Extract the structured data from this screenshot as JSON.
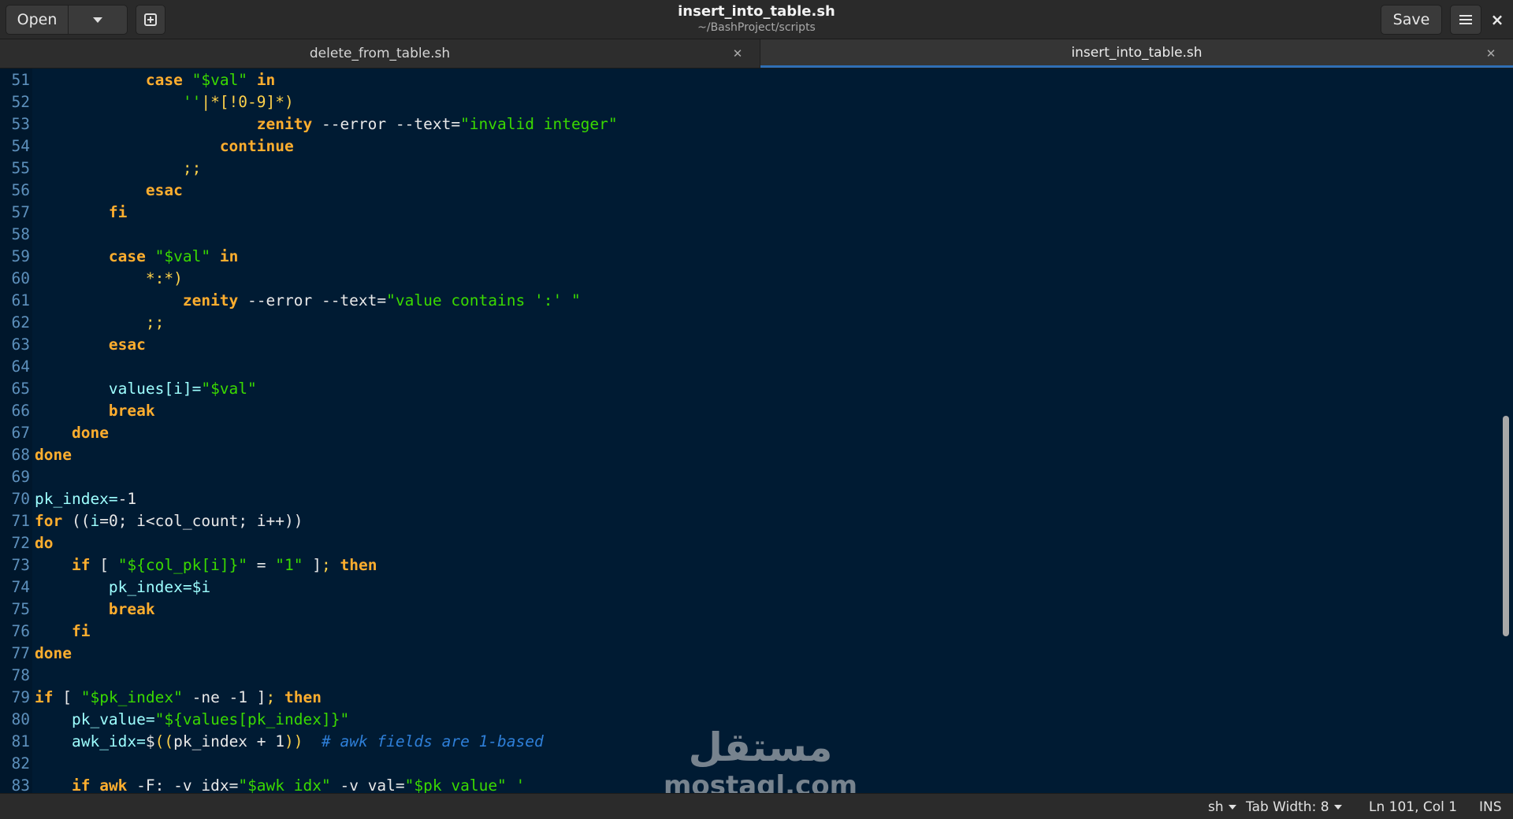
{
  "header": {
    "open_label": "Open",
    "save_label": "Save",
    "title": "insert_into_table.sh",
    "subtitle": "~/BashProject/scripts"
  },
  "tabs": [
    {
      "label": "delete_from_table.sh",
      "active": false
    },
    {
      "label": "insert_into_table.sh",
      "active": true
    }
  ],
  "editor": {
    "lines": [
      {
        "n": "51",
        "tokens": [
          [
            "            ",
            "plain"
          ],
          [
            "case",
            "kw"
          ],
          [
            " ",
            "plain"
          ],
          [
            "\"$val\"",
            "str"
          ],
          [
            " ",
            "plain"
          ],
          [
            "in",
            "kw"
          ]
        ]
      },
      {
        "n": "52",
        "tokens": [
          [
            "                ",
            "plain"
          ],
          [
            "''",
            "str"
          ],
          [
            "|*[!0-9]*)",
            "op"
          ]
        ]
      },
      {
        "n": "53",
        "tokens": [
          [
            "                        ",
            "plain"
          ],
          [
            "zenity",
            "kw"
          ],
          [
            " --error --text=",
            "plain"
          ],
          [
            "\"invalid integer\"",
            "str"
          ]
        ]
      },
      {
        "n": "54",
        "tokens": [
          [
            "                    ",
            "plain"
          ],
          [
            "continue",
            "kw"
          ]
        ]
      },
      {
        "n": "55",
        "tokens": [
          [
            "                ",
            "plain"
          ],
          [
            ";;",
            "op"
          ]
        ]
      },
      {
        "n": "56",
        "tokens": [
          [
            "            ",
            "plain"
          ],
          [
            "esac",
            "kw"
          ]
        ]
      },
      {
        "n": "57",
        "tokens": [
          [
            "        ",
            "plain"
          ],
          [
            "fi",
            "kw"
          ]
        ]
      },
      {
        "n": "58",
        "tokens": []
      },
      {
        "n": "59",
        "tokens": [
          [
            "        ",
            "plain"
          ],
          [
            "case",
            "kw"
          ],
          [
            " ",
            "plain"
          ],
          [
            "\"$val\"",
            "str"
          ],
          [
            " ",
            "plain"
          ],
          [
            "in",
            "kw"
          ]
        ]
      },
      {
        "n": "60",
        "tokens": [
          [
            "            ",
            "plain"
          ],
          [
            "*:*)",
            "op"
          ]
        ]
      },
      {
        "n": "61",
        "tokens": [
          [
            "                ",
            "plain"
          ],
          [
            "zenity",
            "kw"
          ],
          [
            " --error --text=",
            "plain"
          ],
          [
            "\"value contains ':' \"",
            "str"
          ]
        ]
      },
      {
        "n": "62",
        "tokens": [
          [
            "            ",
            "plain"
          ],
          [
            ";;",
            "op"
          ]
        ]
      },
      {
        "n": "63",
        "tokens": [
          [
            "        ",
            "plain"
          ],
          [
            "esac",
            "kw"
          ]
        ]
      },
      {
        "n": "64",
        "tokens": []
      },
      {
        "n": "65",
        "tokens": [
          [
            "        ",
            "plain"
          ],
          [
            "values[i]=",
            "var"
          ],
          [
            "\"$val\"",
            "str"
          ]
        ]
      },
      {
        "n": "66",
        "tokens": [
          [
            "        ",
            "plain"
          ],
          [
            "break",
            "kw"
          ]
        ]
      },
      {
        "n": "67",
        "tokens": [
          [
            "    ",
            "plain"
          ],
          [
            "done",
            "kw"
          ]
        ]
      },
      {
        "n": "68",
        "tokens": [
          [
            "done",
            "kw"
          ]
        ]
      },
      {
        "n": "69",
        "tokens": []
      },
      {
        "n": "70",
        "tokens": [
          [
            "pk_index=",
            "var"
          ],
          [
            "-1",
            "plain"
          ]
        ]
      },
      {
        "n": "71",
        "tokens": [
          [
            "for",
            "kw"
          ],
          [
            " ((",
            "plain"
          ],
          [
            "i",
            "var"
          ],
          [
            "=0; i<col_count; i++))",
            "plain"
          ]
        ]
      },
      {
        "n": "72",
        "tokens": [
          [
            "do",
            "kw"
          ]
        ]
      },
      {
        "n": "73",
        "tokens": [
          [
            "    ",
            "plain"
          ],
          [
            "if",
            "kw"
          ],
          [
            " [ ",
            "plain"
          ],
          [
            "\"${col_pk[i]}\"",
            "str"
          ],
          [
            " = ",
            "plain"
          ],
          [
            "\"1\"",
            "str"
          ],
          [
            " ]",
            "plain"
          ],
          [
            ";",
            "op"
          ],
          [
            " ",
            "plain"
          ],
          [
            "then",
            "kw"
          ]
        ]
      },
      {
        "n": "74",
        "tokens": [
          [
            "        ",
            "plain"
          ],
          [
            "pk_index=$i",
            "var"
          ]
        ]
      },
      {
        "n": "75",
        "tokens": [
          [
            "        ",
            "plain"
          ],
          [
            "break",
            "kw"
          ]
        ]
      },
      {
        "n": "76",
        "tokens": [
          [
            "    ",
            "plain"
          ],
          [
            "fi",
            "kw"
          ]
        ]
      },
      {
        "n": "77",
        "tokens": [
          [
            "done",
            "kw"
          ]
        ]
      },
      {
        "n": "78",
        "tokens": []
      },
      {
        "n": "79",
        "tokens": [
          [
            "if",
            "kw"
          ],
          [
            " [ ",
            "plain"
          ],
          [
            "\"$pk_index\"",
            "str"
          ],
          [
            " -ne -1 ]",
            "plain"
          ],
          [
            ";",
            "op"
          ],
          [
            " ",
            "plain"
          ],
          [
            "then",
            "kw"
          ]
        ]
      },
      {
        "n": "80",
        "tokens": [
          [
            "    ",
            "plain"
          ],
          [
            "pk_value=",
            "var"
          ],
          [
            "\"${values[pk_index]}\"",
            "str"
          ]
        ]
      },
      {
        "n": "81",
        "tokens": [
          [
            "    ",
            "plain"
          ],
          [
            "awk_idx=",
            "var"
          ],
          [
            "$",
            "plain"
          ],
          [
            "((",
            "op"
          ],
          [
            "pk_index + 1",
            "plain"
          ],
          [
            "))",
            "op"
          ],
          [
            "  ",
            "plain"
          ],
          [
            "# awk fields are 1-based",
            "cmt"
          ]
        ]
      },
      {
        "n": "82",
        "tokens": []
      },
      {
        "n": "83",
        "tokens": [
          [
            "    ",
            "plain"
          ],
          [
            "if",
            "kw"
          ],
          [
            " ",
            "plain"
          ],
          [
            "awk",
            "kw"
          ],
          [
            " -F: -v idx=",
            "plain"
          ],
          [
            "\"$awk_idx\"",
            "str"
          ],
          [
            " -v val=",
            "plain"
          ],
          [
            "\"$pk_value\"",
            "str"
          ],
          [
            " '",
            "str"
          ]
        ]
      }
    ]
  },
  "watermark": {
    "arabic": "مستقل",
    "latin": "mostaql.com"
  },
  "statusbar": {
    "language": "sh",
    "tab_width": "Tab Width: 8",
    "position": "Ln 101, Col 1",
    "mode": "INS"
  },
  "colors": {
    "editor_bg": "#001b33",
    "keyword": "#ffae2e",
    "string": "#3ad900",
    "variable": "#9effff",
    "comment": "#2e7fd8",
    "line_number": "#5d90bc",
    "tab_accent": "#2f6fb6"
  },
  "icons": {
    "dropdown": "chevron-down-icon",
    "new_tab": "new-tab-icon",
    "menu": "hamburger-menu-icon",
    "close_window": "close-icon",
    "tab_close": "close-icon"
  }
}
